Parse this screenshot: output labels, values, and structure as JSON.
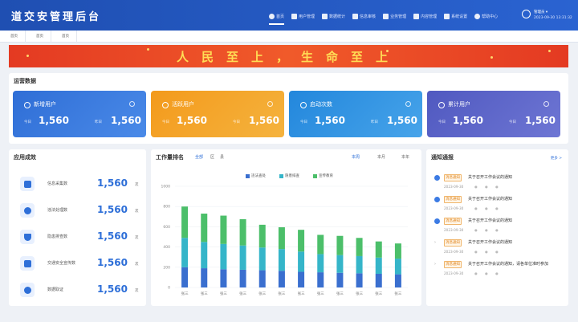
{
  "header": {
    "app_title": "道交安管理后台",
    "nav": [
      {
        "label": "首页",
        "active": true
      },
      {
        "label": "用户管理",
        "active": false
      },
      {
        "label": "数据统计",
        "active": false
      },
      {
        "label": "信息审核",
        "active": false
      },
      {
        "label": "业务管理",
        "active": false
      },
      {
        "label": "内容管理",
        "active": false
      },
      {
        "label": "系统设置",
        "active": false
      },
      {
        "label": "帮助中心",
        "active": false
      }
    ],
    "user": {
      "name": "管理员 ▾",
      "time": "2023-09-30 13:31:32"
    }
  },
  "tabs": [
    "首页",
    "首页",
    "首页"
  ],
  "banner": {
    "text": "人民至上，生命至上"
  },
  "operations": {
    "title": "运营数据",
    "cards": [
      {
        "label": "新增用户",
        "left_label": "今日",
        "left_value": "1,560",
        "right_label": "昨日",
        "right_value": "1,560",
        "color": "#3a78dd"
      },
      {
        "label": "活跃用户",
        "left_label": "今日",
        "left_value": "1,560",
        "right_label": "今日",
        "right_value": "1,560",
        "color": "#f2a024"
      },
      {
        "label": "启动次数",
        "left_label": "今日",
        "left_value": "1,560",
        "right_label": "昨日",
        "right_value": "1,560",
        "color": "#2b93df"
      },
      {
        "label": "累计用户",
        "left_label": "今日",
        "left_value": "1,560",
        "right_label": "今日",
        "right_value": "1,560",
        "color": "#5b63c6"
      }
    ]
  },
  "effect": {
    "title": "应用成效",
    "items": [
      {
        "label": "信息采集数",
        "value": "1,560",
        "unit": "次",
        "icon": "document-icon"
      },
      {
        "label": "违法处理数",
        "value": "1,560",
        "unit": "次",
        "icon": "chat-icon"
      },
      {
        "label": "隐患排查数",
        "value": "1,560",
        "unit": "次",
        "icon": "shield-icon"
      },
      {
        "label": "交通安全宣传数",
        "value": "1,560",
        "unit": "次",
        "icon": "briefcase-icon"
      },
      {
        "label": "数据取证",
        "value": "1,560",
        "unit": "次",
        "icon": "camera-icon"
      }
    ]
  },
  "ranking": {
    "title": "工作量排名",
    "scope_tabs": [
      "全部",
      "区",
      "县"
    ],
    "period_tabs": [
      "本周",
      "本月",
      "本年"
    ],
    "legend": [
      "违法查处",
      "隐患排查",
      "宣传教育"
    ],
    "colors": [
      "#3a6fcf",
      "#35b5c9",
      "#4cbf6a"
    ]
  },
  "chart_data": {
    "type": "bar",
    "stacked": true,
    "categories": [
      "张三",
      "张三",
      "张三",
      "张三",
      "张三",
      "张三",
      "张三",
      "张三",
      "张三",
      "张三",
      "张三",
      "张三"
    ],
    "series": [
      {
        "name": "违法查处",
        "values": [
          200,
          190,
          180,
          175,
          170,
          165,
          155,
          150,
          145,
          140,
          135,
          130
        ]
      },
      {
        "name": "隐患排查",
        "values": [
          290,
          260,
          250,
          240,
          225,
          215,
          200,
          180,
          175,
          170,
          160,
          155
        ]
      },
      {
        "name": "宣传教育",
        "values": [
          310,
          280,
          280,
          260,
          225,
          215,
          215,
          190,
          190,
          180,
          160,
          150
        ]
      }
    ],
    "yticks": [
      0,
      200,
      400,
      600,
      800,
      1000
    ],
    "ylim": [
      0,
      1000
    ],
    "legend_position": "top"
  },
  "notices": {
    "title": "通知通报",
    "more": "更多 >",
    "items": [
      {
        "tag": "消息通知",
        "title": "关于召开工作会议的通知",
        "time": "2023-09-30"
      },
      {
        "tag": "消息通知",
        "title": "关于召开工作会议的通知",
        "time": "2023-09-30"
      },
      {
        "tag": "消息通知",
        "title": "关于召开工作会议的通知",
        "time": "2023-09-30"
      },
      {
        "tag": "消息通知",
        "title": "关于召开工作会议的通知",
        "time": "2023-09-30"
      },
      {
        "tag": "消息通知",
        "title": "关于召开工作会议的通知，请各单位准时参加",
        "time": "2023-09-30"
      }
    ]
  }
}
